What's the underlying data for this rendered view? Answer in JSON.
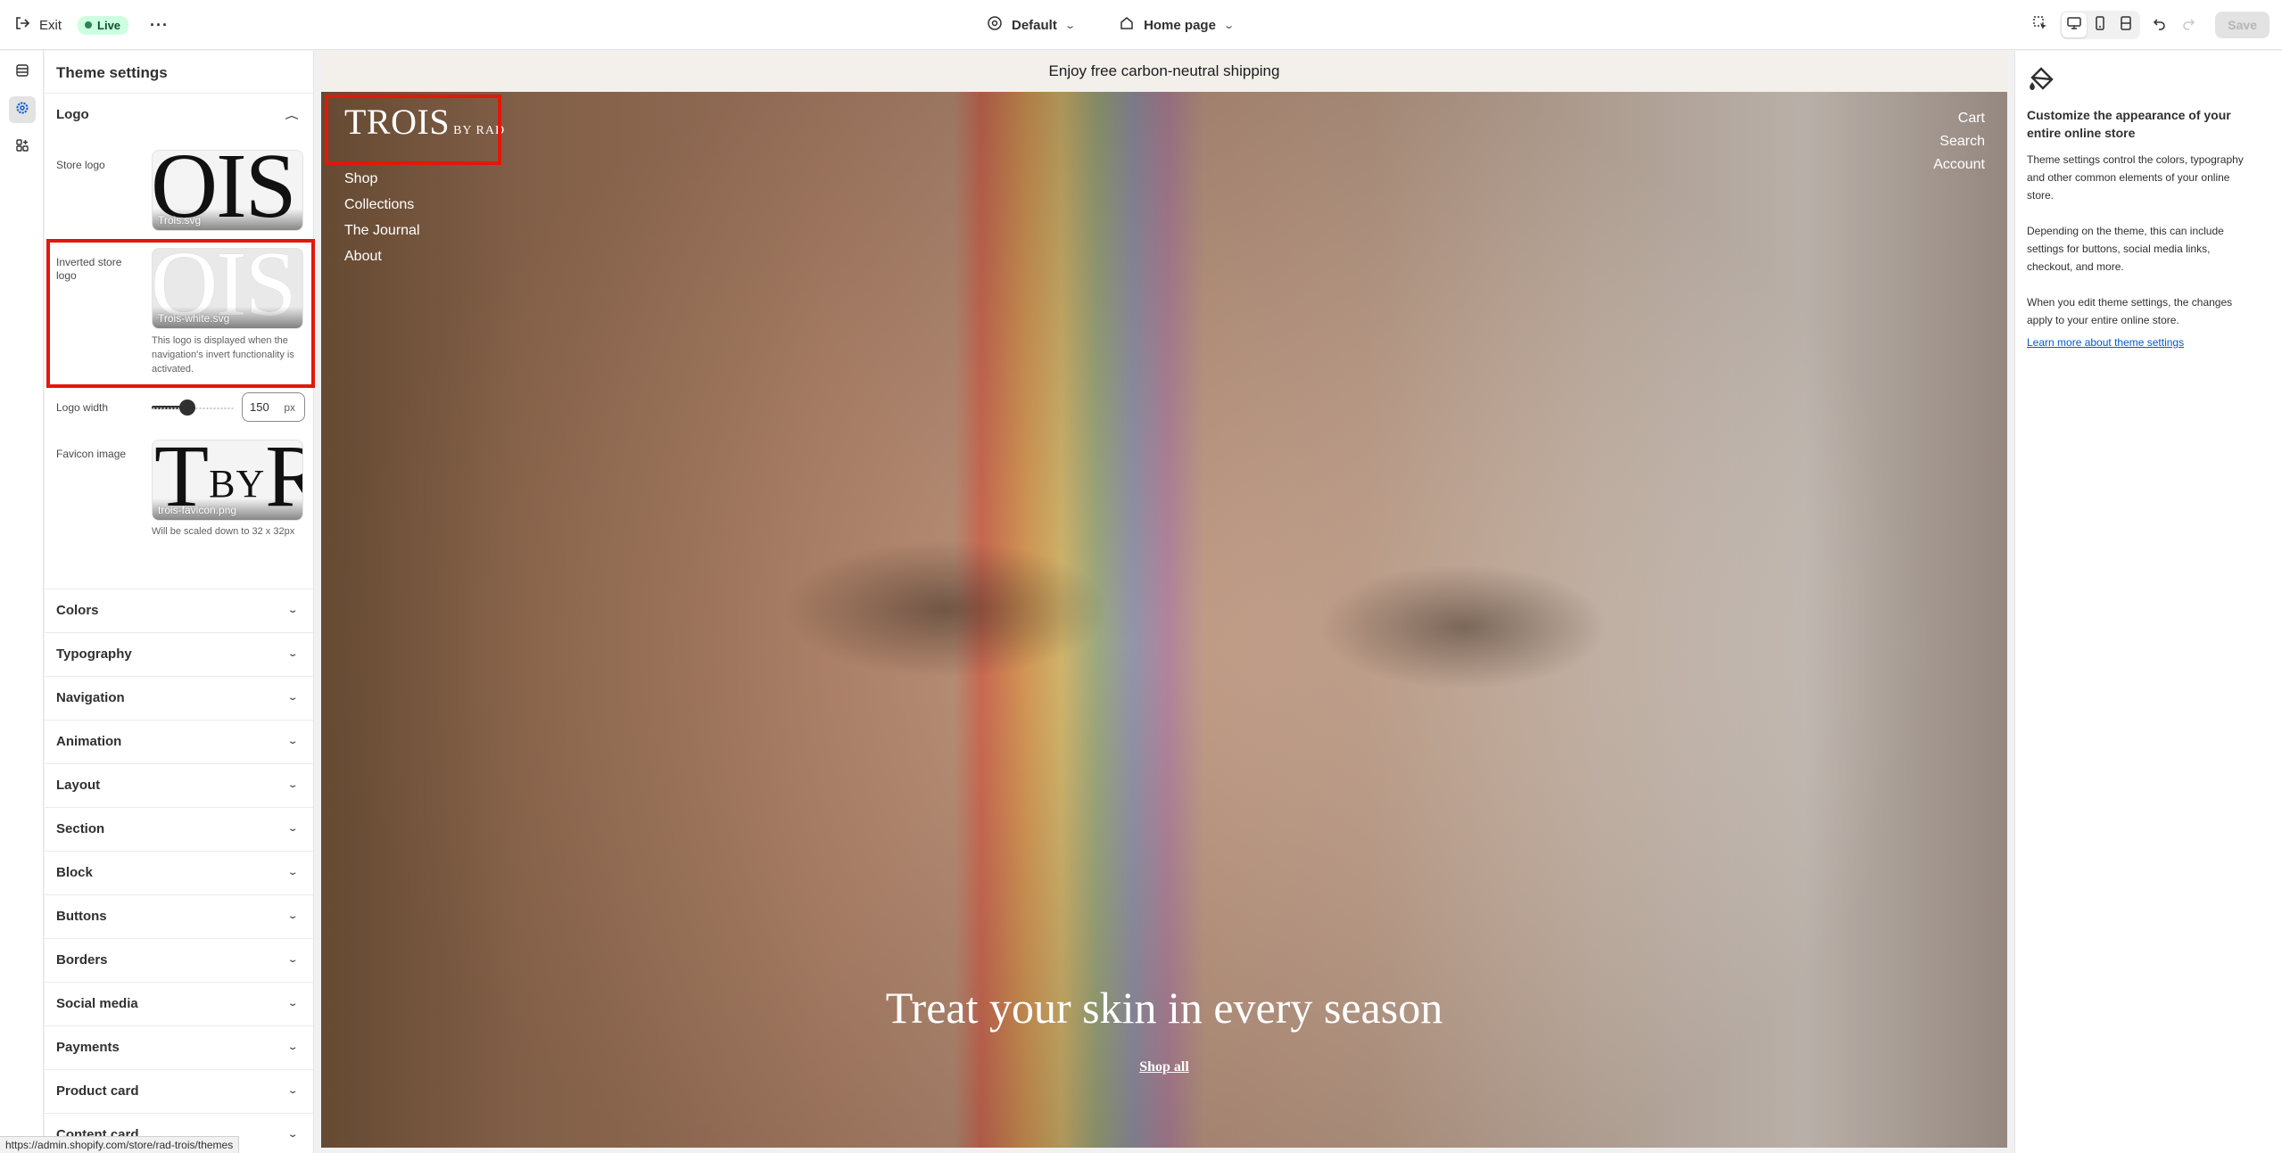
{
  "topbar": {
    "exit_label": "Exit",
    "live_label": "Live",
    "theme_select": "Default",
    "page_select": "Home page",
    "save_label": "Save"
  },
  "rail": {
    "items": [
      "sections-icon",
      "theme-settings-icon",
      "apps-icon"
    ],
    "active": "theme-settings-icon"
  },
  "panel": {
    "title": "Theme settings",
    "logo_section": {
      "label": "Logo",
      "store_logo_label": "Store logo",
      "store_logo_file": "Trois.svg",
      "store_logo_preview": "OIS",
      "inverted_logo_label": "Inverted store logo",
      "inverted_logo_file": "Trois-white.svg",
      "inverted_logo_preview": "OIS",
      "inverted_logo_help": "This logo is displayed when the navigation's invert functionality is activated.",
      "logo_width_label": "Logo width",
      "logo_width_value": "150",
      "logo_width_unit": "px",
      "logo_width_slider_percent": 43,
      "favicon_label": "Favicon image",
      "favicon_file": "trois-favicon.png",
      "favicon_preview_t": "T",
      "favicon_preview_by": "BY",
      "favicon_preview_r": "R",
      "favicon_help": "Will be scaled down to 32 x 32px"
    },
    "sections": [
      "Colors",
      "Typography",
      "Navigation",
      "Animation",
      "Layout",
      "Section",
      "Block",
      "Buttons",
      "Borders",
      "Social media",
      "Payments",
      "Product card",
      "Content card"
    ]
  },
  "preview": {
    "announcement": "Enjoy free carbon-neutral shipping",
    "logo_main": "TROIS",
    "logo_sub": "BY RAD",
    "nav_left": [
      "Shop",
      "Collections",
      "The Journal",
      "About"
    ],
    "nav_right": [
      "Cart",
      "Search",
      "Account"
    ],
    "hero_title": "Treat your skin in every season",
    "hero_cta": "Shop all"
  },
  "info": {
    "title": "Customize the appearance of your entire online store",
    "p1": "Theme settings control the colors, typography and other common elements of your online store.",
    "p2": "Depending on the theme, this can include settings for buttons, social media links, checkout, and more.",
    "p3": "When you edit theme settings, the changes apply to your entire online store.",
    "link": "Learn more about theme settings"
  },
  "status_url": "https://admin.shopify.com/store/rad-trois/themes",
  "colors": {
    "highlight": "#e3170a",
    "live_badge_bg": "#cdfee1",
    "link": "#005bd3"
  }
}
